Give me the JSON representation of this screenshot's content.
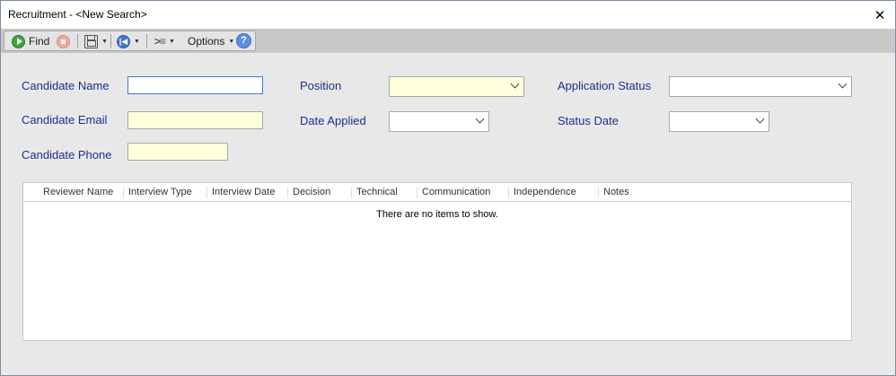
{
  "window": {
    "title": "Recruitment - <New Search>"
  },
  "toolbar": {
    "find_label": "Find",
    "options_label": "Options"
  },
  "form": {
    "candidate_name_label": "Candidate Name",
    "candidate_email_label": "Candidate Email",
    "candidate_phone_label": "Candidate Phone",
    "position_label": "Position",
    "date_applied_label": "Date Applied",
    "application_status_label": "Application Status",
    "status_date_label": "Status Date"
  },
  "grid": {
    "columns": [
      "Reviewer Name",
      "Interview Type",
      "Interview Date",
      "Decision",
      "Technical",
      "Communication",
      "Independence",
      "Notes"
    ],
    "empty_message": "There are no items to show."
  },
  "colors": {
    "label": "#1c2f8c",
    "required_field": "#ffffdd",
    "toolbar": "#c8c8c8"
  }
}
